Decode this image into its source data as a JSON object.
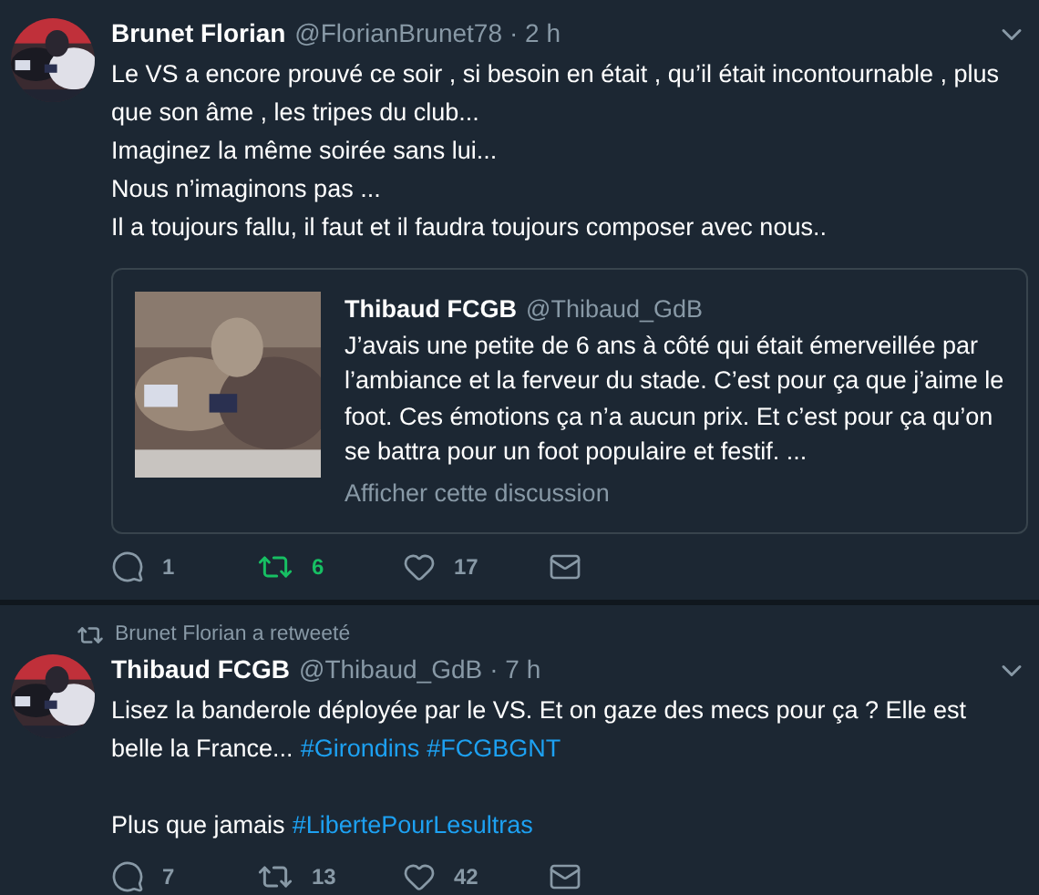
{
  "tweets": [
    {
      "name": "Brunet Florian",
      "handle": "@FlorianBrunet78",
      "time": "· 2 h",
      "paragraphs": [
        [
          {
            "kind": "text",
            "text": "Le VS a encore prouvé ce soir , si besoin en était , qu’il était incontournable , plus que son âme , les tripes du club..."
          }
        ],
        [
          {
            "kind": "text",
            "text": "Imaginez la même soirée sans lui..."
          }
        ],
        [
          {
            "kind": "text",
            "text": "Nous n’imaginons pas ..."
          }
        ],
        [
          {
            "kind": "text",
            "text": "Il a toujours fallu, il faut et il faudra toujours composer avec nous.."
          }
        ]
      ],
      "quote": {
        "name": "Thibaud FCGB",
        "handle": "@Thibaud_GdB",
        "text": "J’avais une petite de 6 ans à côté qui était émerveillée par l’ambiance et la ferveur du stade. C’est pour ça que j’aime le foot. Ces émotions ça n’a aucun prix. Et c’est pour ça qu’on se battra pour un foot populaire et festif. ...",
        "link": "Afficher cette discussion"
      },
      "replies": "1",
      "retweets": "6",
      "retweeted": true,
      "likes": "17"
    },
    {
      "retweeted_by": "Brunet Florian a retweeté",
      "name": "Thibaud FCGB",
      "handle": "@Thibaud_GdB",
      "time": "· 7 h",
      "paragraphs": [
        [
          {
            "kind": "text",
            "text": "Lisez la banderole déployée par le VS. Et on gaze des mecs pour ça ? Elle est belle la France..."
          },
          {
            "kind": "hashtag",
            "text": "#Girondins"
          },
          {
            "kind": "hashtag",
            "text": "#FCGBGNT"
          }
        ],
        [
          {
            "kind": "text",
            "text": "Plus que jamais"
          },
          {
            "kind": "hashtag",
            "text": "#LibertePourLesultras"
          }
        ]
      ],
      "replies": "7",
      "retweets": "13",
      "retweeted": false,
      "likes": "42"
    }
  ]
}
